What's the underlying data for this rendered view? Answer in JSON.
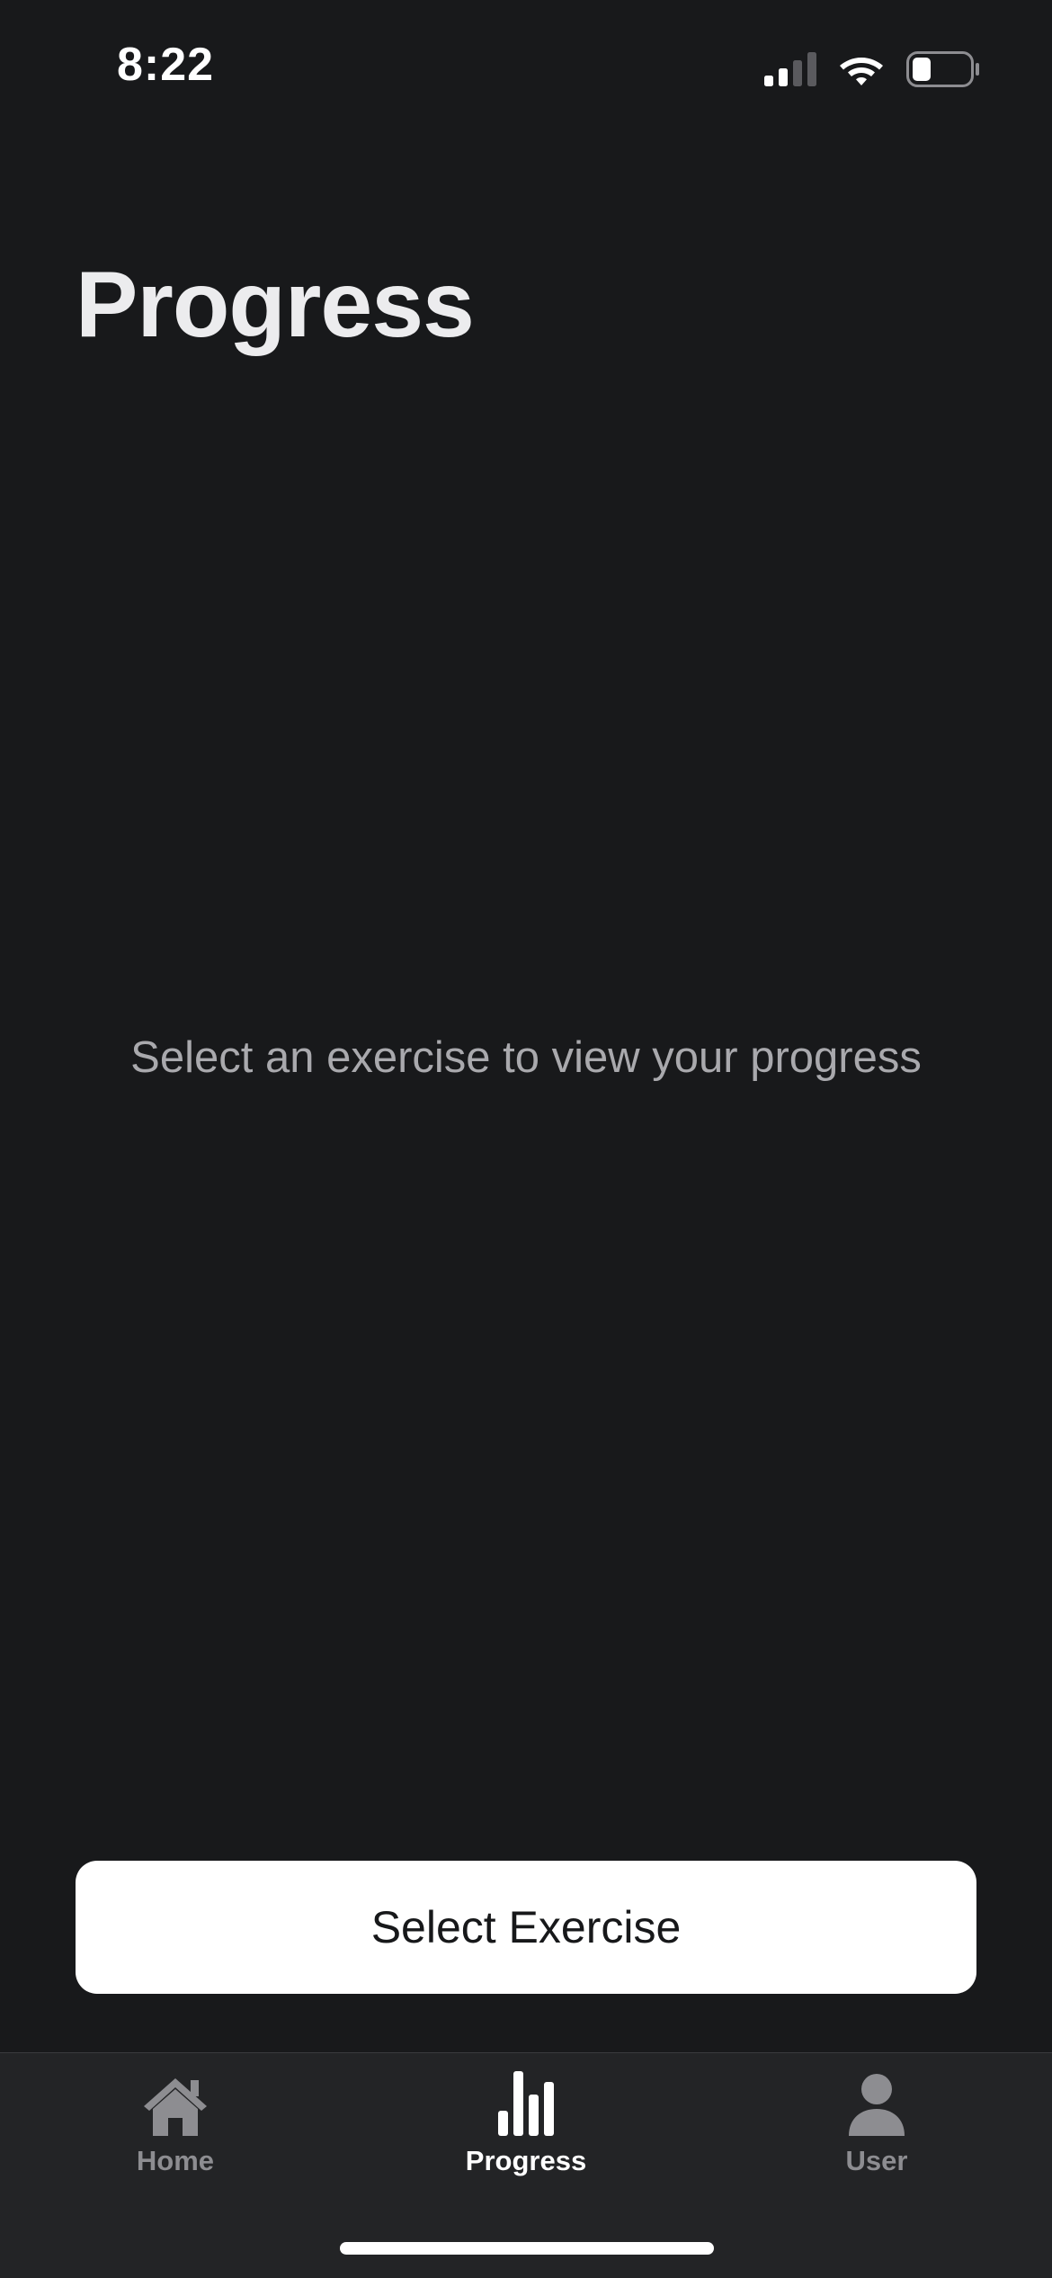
{
  "status_bar": {
    "time": "8:22",
    "icons": [
      "signal-icon",
      "wifi-icon",
      "battery-icon"
    ]
  },
  "header": {
    "title": "Progress"
  },
  "main": {
    "empty_message": "Select an exercise to view your progress",
    "select_button_label": "Select Exercise"
  },
  "tab_bar": {
    "tabs": [
      {
        "label": "Home",
        "icon": "home-icon",
        "active": false
      },
      {
        "label": "Progress",
        "icon": "bar-chart-icon",
        "active": true
      },
      {
        "label": "User",
        "icon": "user-icon",
        "active": false
      }
    ]
  },
  "colors": {
    "background": "#18191b",
    "tab_bar_background": "#232426",
    "title": "#ececee",
    "muted_text": "#a9a9ad",
    "inactive_tab": "#8d8d91",
    "active_tab": "#ffffff",
    "button_background": "#ffffff",
    "button_text": "#17181a"
  }
}
